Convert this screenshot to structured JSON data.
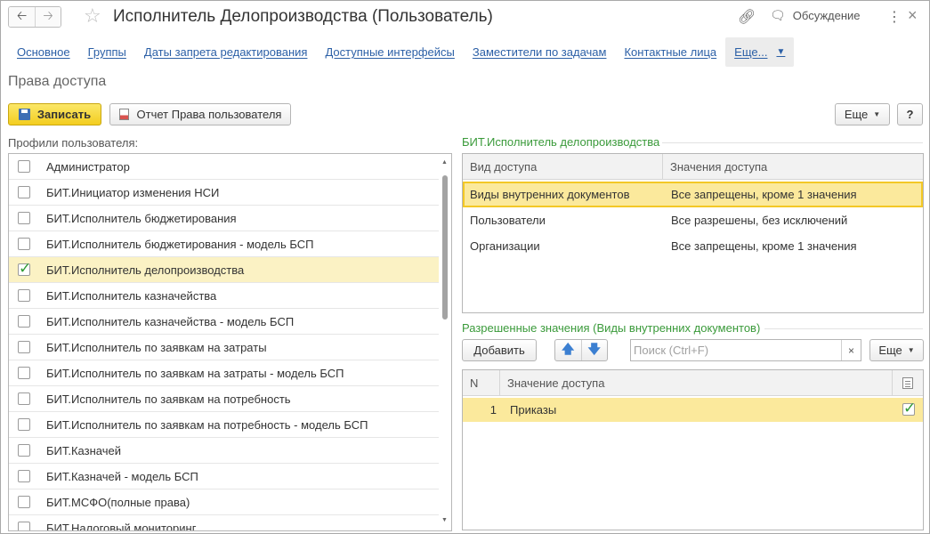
{
  "titlebar": {
    "title": "Исполнитель Делопроизводства (Пользователь)",
    "discuss_label": "Обсуждение",
    "icons": [
      "back-arrow-icon",
      "forward-arrow-icon",
      "star-icon",
      "link-icon",
      "chat-icon",
      "kebab-menu-icon",
      "close-icon"
    ]
  },
  "tabs": [
    {
      "label": "Основное"
    },
    {
      "label": "Группы"
    },
    {
      "label": "Даты запрета редактирования"
    },
    {
      "label": "Доступные интерфейсы"
    },
    {
      "label": "Заместители по задачам"
    },
    {
      "label": "Контактные лица"
    },
    {
      "label": "Еще..."
    }
  ],
  "section_title": "Права доступа",
  "toolbar": {
    "save_label": "Записать",
    "report_label": "Отчет Права пользователя",
    "more_label": "Еще",
    "help_label": "?"
  },
  "profiles": {
    "label": "Профили пользователя:",
    "items": [
      {
        "label": "Администратор",
        "checked": false
      },
      {
        "label": "БИТ.Инициатор изменения НСИ",
        "checked": false
      },
      {
        "label": "БИТ.Исполнитель бюджетирования",
        "checked": false
      },
      {
        "label": "БИТ.Исполнитель бюджетирования - модель БСП",
        "checked": false
      },
      {
        "label": "БИТ.Исполнитель делопроизводства",
        "checked": true
      },
      {
        "label": "БИТ.Исполнитель казначейства",
        "checked": false
      },
      {
        "label": "БИТ.Исполнитель казначейства - модель БСП",
        "checked": false
      },
      {
        "label": "БИТ.Исполнитель по заявкам на затраты",
        "checked": false
      },
      {
        "label": "БИТ.Исполнитель по заявкам на затраты - модель БСП",
        "checked": false
      },
      {
        "label": "БИТ.Исполнитель по заявкам на потребность",
        "checked": false
      },
      {
        "label": "БИТ.Исполнитель по заявкам на потребность - модель БСП",
        "checked": false
      },
      {
        "label": "БИТ.Казначей",
        "checked": false
      },
      {
        "label": "БИТ.Казначей - модель БСП",
        "checked": false
      },
      {
        "label": "БИТ.МСФО(полные права)",
        "checked": false
      },
      {
        "label": "БИТ.Налоговый мониторинг",
        "checked": false
      }
    ]
  },
  "access_group": {
    "title": "БИТ.Исполнитель делопроизводства",
    "columns": [
      "Вид доступа",
      "Значения доступа"
    ],
    "rows": [
      {
        "kind": "Виды внутренних документов",
        "value": "Все запрещены, кроме 1 значения"
      },
      {
        "kind": "Пользователи",
        "value": "Все разрешены, без исключений"
      },
      {
        "kind": "Организации",
        "value": "Все запрещены, кроме 1 значения"
      }
    ]
  },
  "allowed": {
    "title": "Разрешенные значения (Виды внутренних документов)",
    "add_label": "Добавить",
    "search_placeholder": "Поиск (Ctrl+F)",
    "clear_label": "×",
    "more_label": "Еще",
    "columns": [
      "N",
      "Значение доступа"
    ],
    "rows": [
      {
        "n": "1",
        "value": "Приказы",
        "checked": true
      }
    ]
  }
}
